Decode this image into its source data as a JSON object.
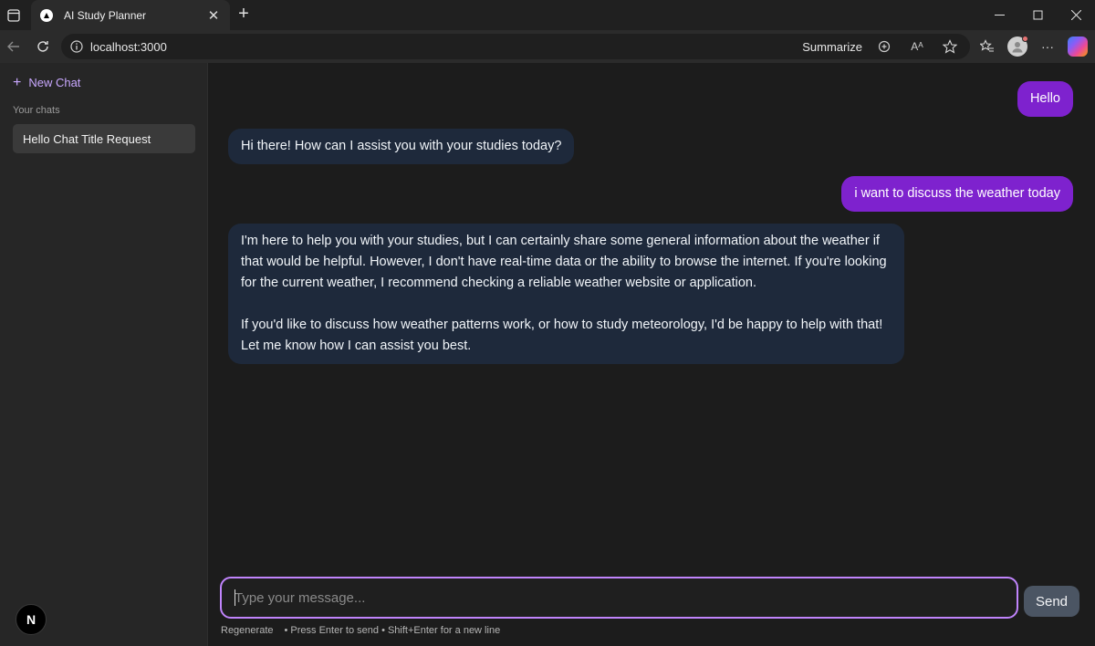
{
  "browser": {
    "tab_title": "AI Study Planner",
    "url": "localhost:3000",
    "summarize_label": "Summarize",
    "read_aloud_label": "Aᴬ"
  },
  "sidebar": {
    "new_chat_label": "New Chat",
    "section_label": "Your chats",
    "chats": [
      {
        "title": "Hello Chat Title Request"
      }
    ],
    "badge_label": "N"
  },
  "conversation": {
    "messages": [
      {
        "role": "user",
        "text": "Hello"
      },
      {
        "role": "assistant",
        "text": "Hi there! How can I assist you with your studies today?"
      },
      {
        "role": "user",
        "text": "i want to discuss the weather today"
      },
      {
        "role": "assistant",
        "paragraphs": [
          "I'm here to help you with your studies, but I can certainly share some general information about the weather if that would be helpful. However, I don't have real-time data or the ability to browse the internet. If you're looking for the current weather, I recommend checking a reliable weather website or application.",
          "If you'd like to discuss how weather patterns work, or how to study meteorology, I'd be happy to help with that! Let me know how I can assist you best."
        ]
      }
    ]
  },
  "composer": {
    "placeholder": "Type your message...",
    "send_label": "Send",
    "regenerate_label": "Regenerate",
    "hint": "• Press Enter to send • Shift+Enter for a new line"
  },
  "colors": {
    "accent": "#7e22ce",
    "accent_light": "#c084fc",
    "assistant_bubble": "#1e293b",
    "sidebar_bg": "#262626",
    "main_bg": "#1c1c1c"
  }
}
